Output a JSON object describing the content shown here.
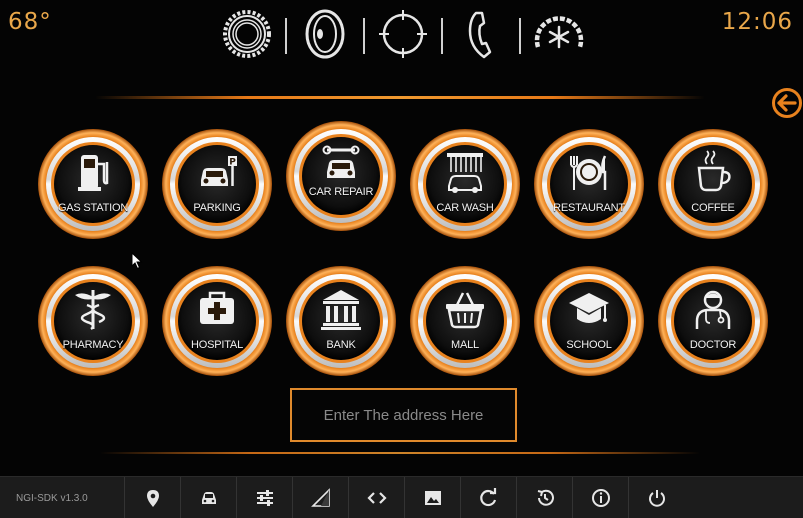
{
  "status": {
    "temperature": "68°",
    "clock": "12:06"
  },
  "top_icons": [
    "settings-gear-icon",
    "media-disc-icon",
    "navigation-crosshair-icon",
    "phone-icon",
    "climate-fan-icon"
  ],
  "back_icon": "back-arrow-icon",
  "pois": [
    {
      "label": "GAS STATION",
      "icon": "gas-station-icon"
    },
    {
      "label": "PARKING",
      "icon": "parking-icon"
    },
    {
      "label": "CAR REPAIR",
      "icon": "car-repair-icon"
    },
    {
      "label": "CAR WASH",
      "icon": "car-wash-icon"
    },
    {
      "label": "RESTAURANT",
      "icon": "restaurant-icon"
    },
    {
      "label": "COFFEE",
      "icon": "coffee-icon"
    },
    {
      "label": "PHARMACY",
      "icon": "pharmacy-icon"
    },
    {
      "label": "HOSPITAL",
      "icon": "hospital-icon"
    },
    {
      "label": "BANK",
      "icon": "bank-icon"
    },
    {
      "label": "MALL",
      "icon": "mall-basket-icon"
    },
    {
      "label": "SCHOOL",
      "icon": "school-icon"
    },
    {
      "label": "DOCTOR",
      "icon": "doctor-icon"
    }
  ],
  "address": {
    "placeholder": "Enter The address Here"
  },
  "bottom_bar": {
    "version": "NGI-SDK v1.3.0",
    "icons": [
      "map-pin-icon",
      "car-icon",
      "sliders-icon",
      "signal-icon",
      "code-icon",
      "image-icon",
      "refresh-icon",
      "history-icon",
      "info-icon",
      "power-icon"
    ]
  },
  "colors": {
    "accent": "#e8821e",
    "text": "#e9a74a",
    "background": "#040404",
    "bar": "#1c1c1c"
  }
}
